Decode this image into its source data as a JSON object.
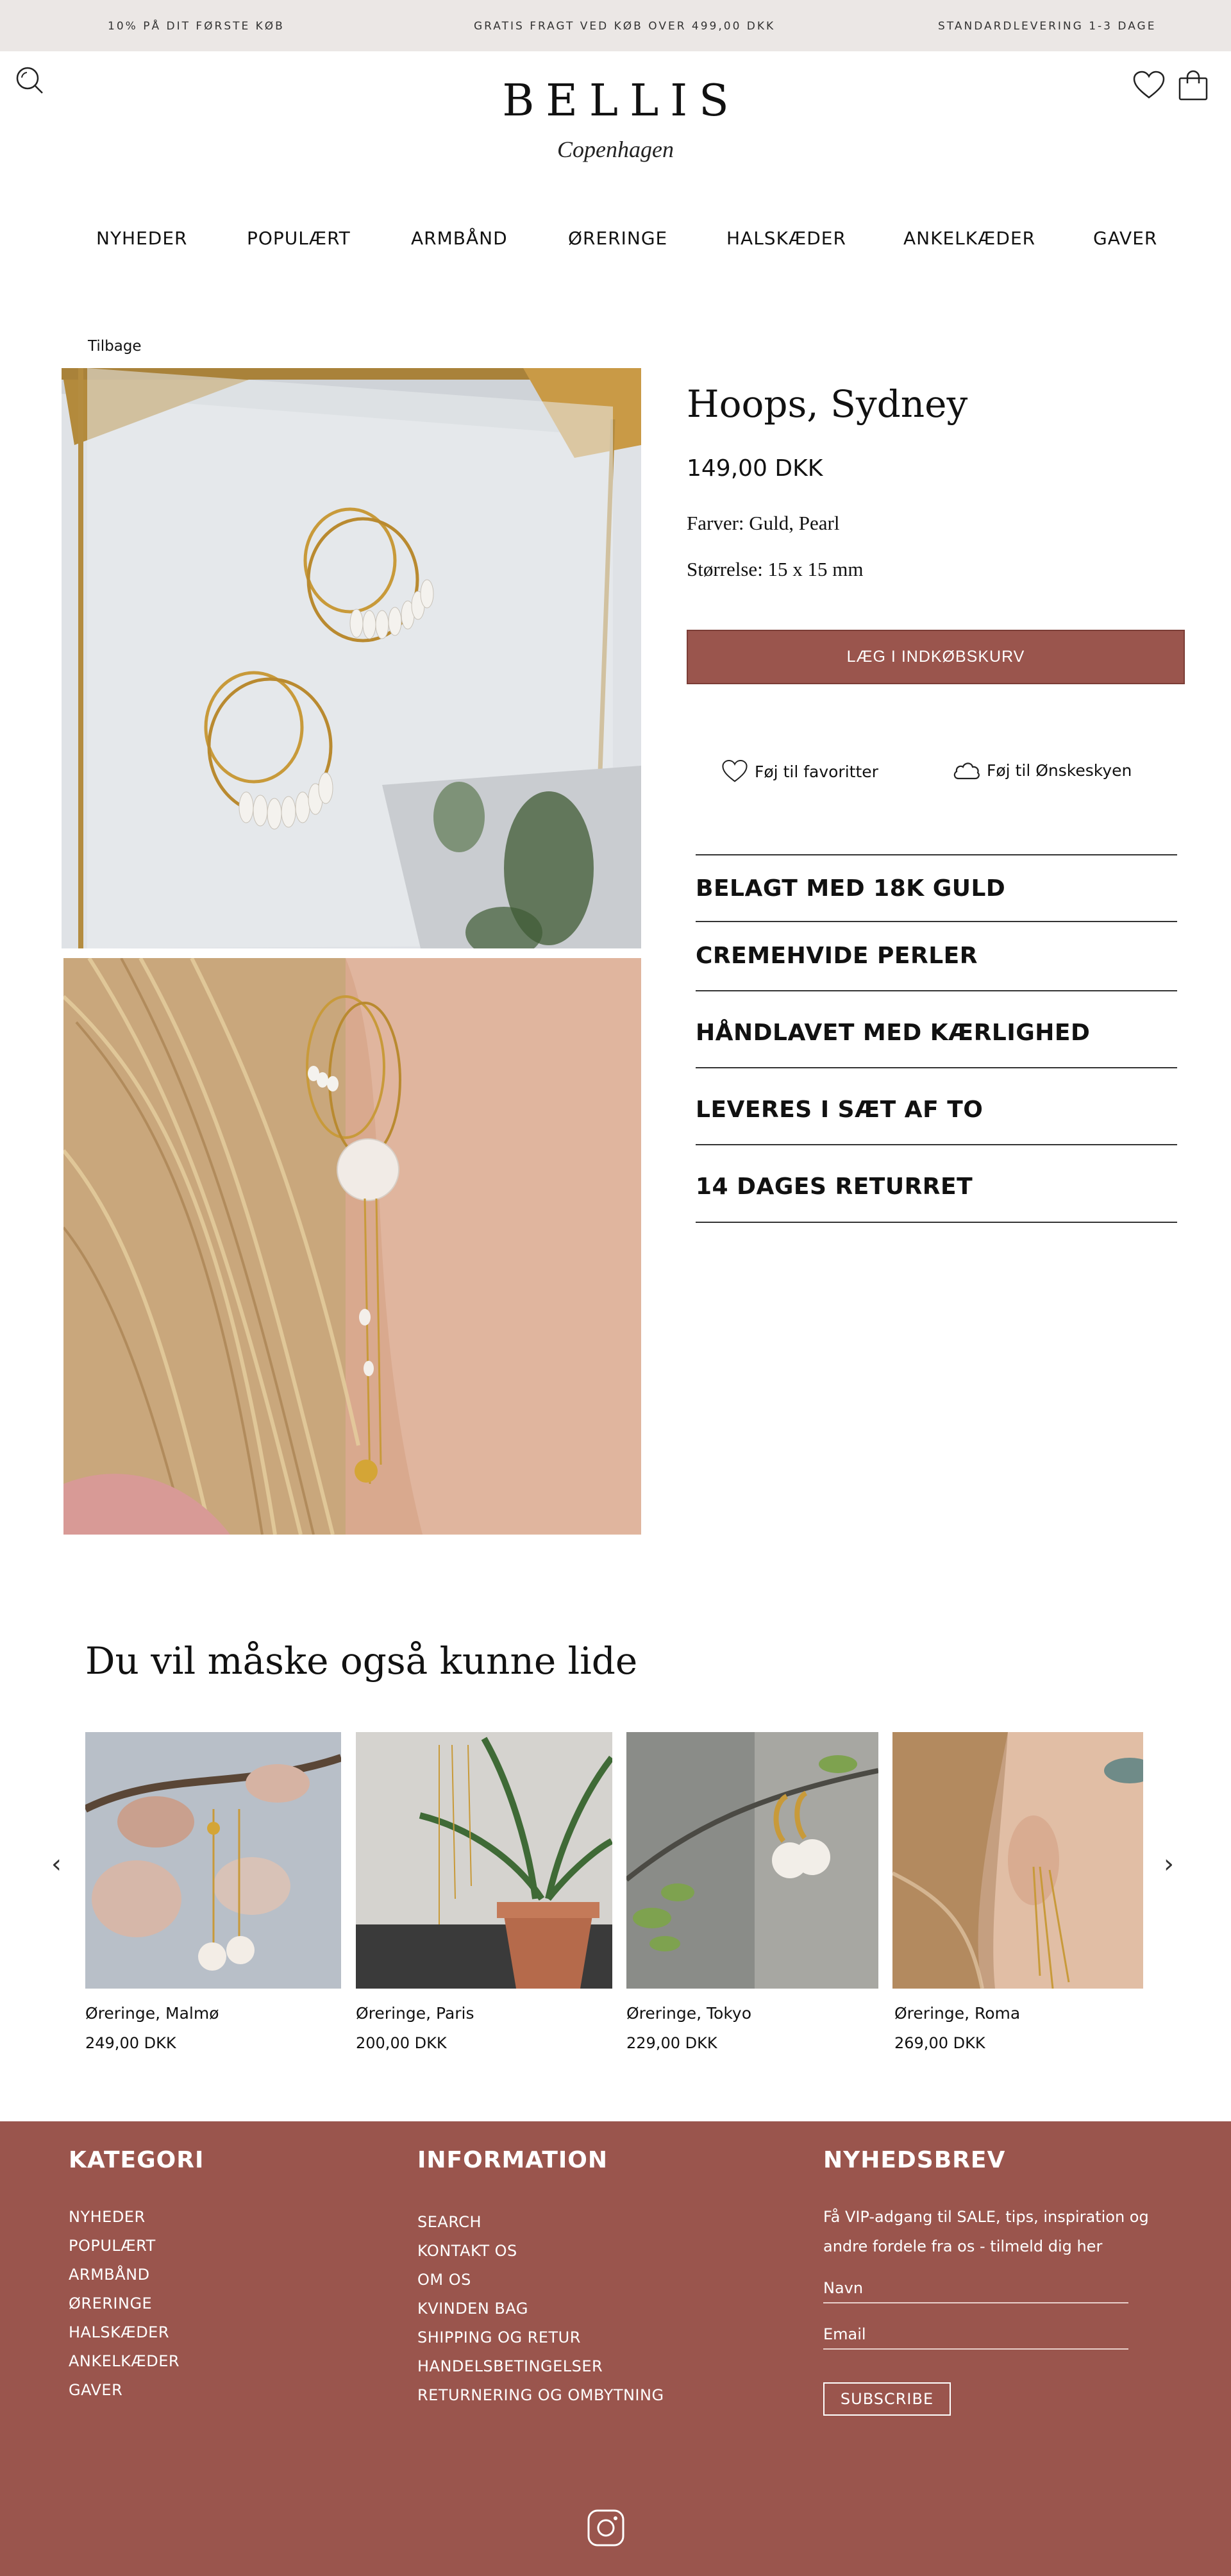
{
  "announcement": {
    "left": "10% PÅ DIT FØRSTE KØB",
    "center": "GRATIS FRAGT VED KØB OVER 499,00 DKK",
    "right": "STANDARDLEVERING 1-3 DAGE"
  },
  "header": {
    "logo": "BELLIS",
    "logo_sub": "Copenhagen",
    "icons": [
      "search-icon",
      "heart-icon",
      "cart-icon"
    ]
  },
  "nav": [
    "NYHEDER",
    "POPULÆRT",
    "ARMBÅND",
    "ØRERINGE",
    "HALSKÆDER",
    "ANKELKÆDER",
    "GAVER"
  ],
  "back_label": "Tilbage",
  "product": {
    "title": "Hoops, Sydney",
    "price": "149,00 DKK",
    "color": "Farver: Guld, Pearl",
    "size": "Størrelse: 15 x 15 mm",
    "add_to_cart": "LÆG I INDKØBSKURV",
    "favorite_label": "Føj til favoritter",
    "wishcloud_label": "Føj til Ønskeskyen",
    "features": [
      "BELAGT MED 18K GULD",
      "CREMEHVIDE PERLER",
      "HÅNDLAVET MED KÆRLIGHED",
      "LEVERES I SÆT AF TO",
      "14 DAGES RETURRET"
    ]
  },
  "recommendations": {
    "title": "Du vil måske også kunne lide",
    "items": [
      {
        "name": "Øreringe, Malmø",
        "price": "249,00 DKK"
      },
      {
        "name": "Øreringe, Paris",
        "price": "200,00 DKK"
      },
      {
        "name": "Øreringe, Tokyo",
        "price": "229,00 DKK"
      },
      {
        "name": "Øreringe, Roma",
        "price": "269,00 DKK"
      }
    ]
  },
  "footer": {
    "kategori_title": "KATEGORI",
    "kategori": [
      "NYHEDER",
      "POPULÆRT",
      "ARMBÅND",
      "ØRERINGE",
      "HALSKÆDER",
      "ANKELKÆDER",
      "GAVER"
    ],
    "info_title": "INFORMATION",
    "info": [
      "SEARCH",
      "KONTAKT OS",
      "OM OS",
      "KVINDEN BAG",
      "SHIPPING OG RETUR",
      "HANDELSBETINGELSER",
      "RETURNERING OG OMBYTNING"
    ],
    "newsletter_title": "NYHEDSBREV",
    "newsletter_text": "Få VIP-adgang til SALE, tips, inspiration og andre fordele fra os - tilmeld dig her",
    "name_placeholder": "Navn",
    "email_placeholder": "Email",
    "subscribe": "SUBSCRIBE"
  },
  "colors": {
    "accent": "#9a554d",
    "topbar": "#ebe7e5"
  }
}
